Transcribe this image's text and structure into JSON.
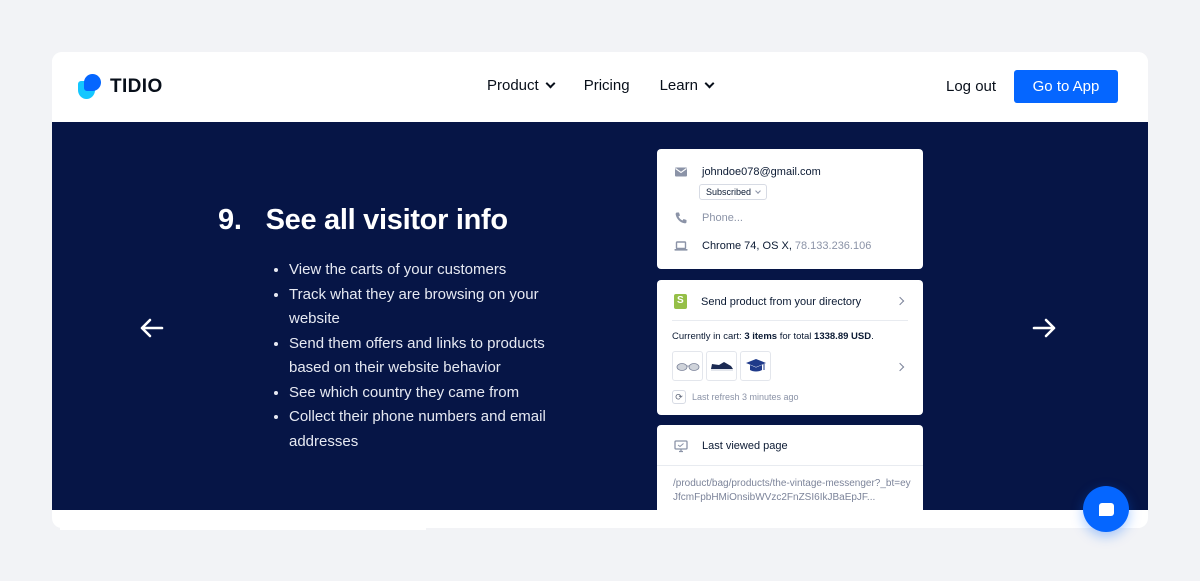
{
  "nav": {
    "logo_text": "TIDIO",
    "items": [
      {
        "label": "Product",
        "has_dropdown": true
      },
      {
        "label": "Pricing",
        "has_dropdown": false
      },
      {
        "label": "Learn",
        "has_dropdown": true
      }
    ],
    "logout_label": "Log out",
    "cta_label": "Go to App"
  },
  "hero": {
    "number": "9.",
    "title": "See all visitor info",
    "bullets": [
      "View the carts of your customers",
      "Track what they are browsing on your website",
      "Send them offers and links to products based on their website behavior",
      "See which country they came from",
      "Collect their phone numbers and email addresses"
    ],
    "prev_icon": "arrow-left-icon",
    "next_icon": "arrow-right-icon"
  },
  "visitor_card": {
    "email": "johndoe078@gmail.com",
    "subscription_status": "Subscribed",
    "phone_placeholder": "Phone...",
    "browser": "Chrome 74, OS X,",
    "ip": "78.133.236.106"
  },
  "cart_card": {
    "title": "Send product from your directory",
    "cart_prefix": "Currently in cart: ",
    "items_count": "3 items",
    "total_mid": " for total ",
    "total": "1338.89 USD",
    "total_suffix": ".",
    "last_refresh": "Last refresh 3 minutes ago"
  },
  "page_card": {
    "title": "Last viewed page",
    "url": "/product/bag/products/the-vintage-messenger?_bt=eyJfcmFpbHMiOnsibWVzc2FnZSI6IkJBaEpJF..."
  },
  "colors": {
    "brand": "#0566ff",
    "hero_bg": "#061546",
    "page_bg": "#f2f3f6"
  }
}
